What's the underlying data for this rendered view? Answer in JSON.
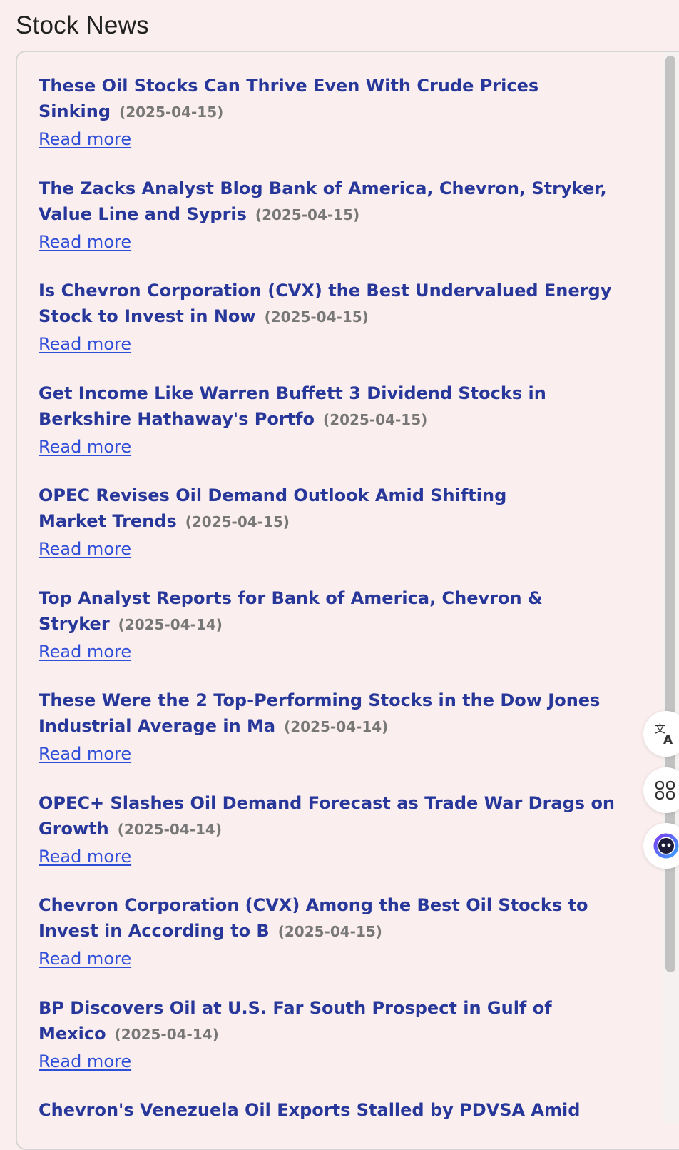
{
  "page": {
    "title": "Stock News"
  },
  "news": {
    "items": [
      {
        "title": "These Oil Stocks Can Thrive Even With Crude Prices Sinking",
        "date": "(2025-04-15)",
        "link_label": "Read more"
      },
      {
        "title": "The Zacks Analyst Blog Bank of America, Chevron, Stryker, Value Line and Sypris",
        "date": "(2025-04-15)",
        "link_label": "Read more"
      },
      {
        "title": "Is Chevron Corporation (CVX) the Best Undervalued Energy Stock to Invest in Now",
        "date": "(2025-04-15)",
        "link_label": "Read more"
      },
      {
        "title": "Get Income Like Warren Buffett 3 Dividend Stocks in Berkshire Hathaway's Portfo",
        "date": "(2025-04-15)",
        "link_label": "Read more"
      },
      {
        "title": "OPEC Revises Oil Demand Outlook Amid Shifting Market Trends",
        "date": "(2025-04-15)",
        "link_label": "Read more"
      },
      {
        "title": "Top Analyst Reports for Bank of America, Chevron & Stryker",
        "date": "(2025-04-14)",
        "link_label": "Read more"
      },
      {
        "title": "These Were the 2 Top-Performing Stocks in the Dow Jones Industrial Average in Ma",
        "date": "(2025-04-14)",
        "link_label": "Read more"
      },
      {
        "title": "OPEC+ Slashes Oil Demand Forecast as Trade War Drags on Growth",
        "date": "(2025-04-14)",
        "link_label": "Read more"
      },
      {
        "title": "Chevron Corporation (CVX) Among the Best Oil Stocks to Invest in According to B",
        "date": "(2025-04-15)",
        "link_label": "Read more"
      },
      {
        "title": "BP Discovers Oil at U.S. Far South Prospect in Gulf of Mexico",
        "date": "(2025-04-14)",
        "link_label": "Read more"
      },
      {
        "title": "Chevron's Venezuela Oil Exports Stalled by PDVSA Amid",
        "date": "",
        "link_label": ""
      }
    ]
  },
  "floating_actions": [
    {
      "icon": "translate-icon"
    },
    {
      "icon": "apps-grid-icon"
    },
    {
      "icon": "assistant-face-icon"
    }
  ],
  "colors": {
    "background": "#fbeeee",
    "headline": "#28389a",
    "date": "#777777",
    "link": "#2f4ed8"
  }
}
